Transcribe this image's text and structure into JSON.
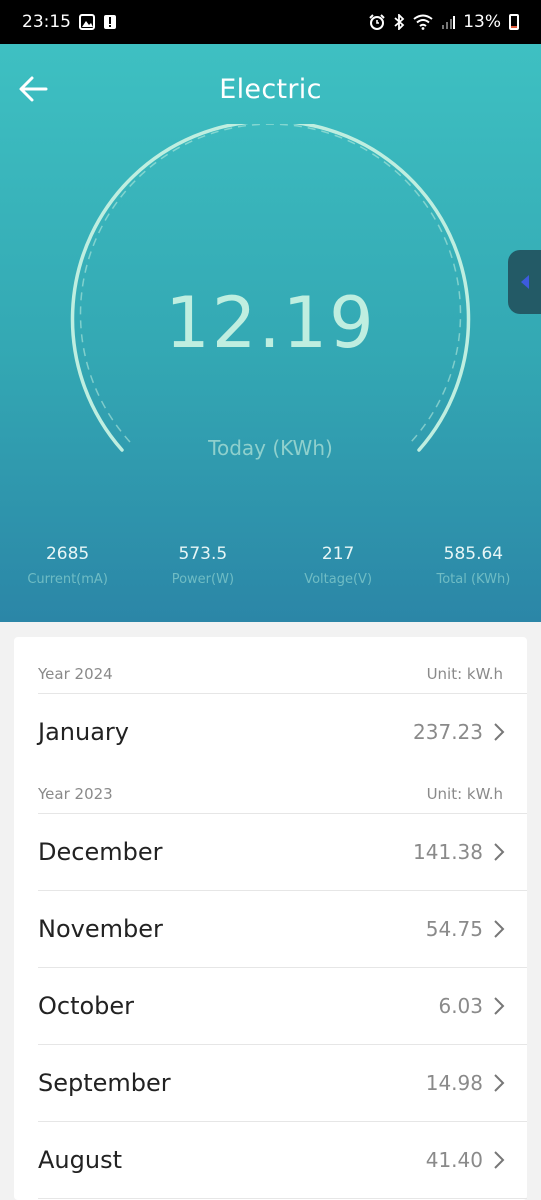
{
  "status_bar": {
    "time": "23:15",
    "battery": "13%",
    "icons": [
      "gallery-icon",
      "alert-icon",
      "alarm-icon",
      "bluetooth-icon",
      "wifi-icon",
      "signal-icon",
      "battery-icon"
    ]
  },
  "header": {
    "title": "Electric",
    "back_icon": "arrow-left-icon"
  },
  "gauge": {
    "value": "12.19",
    "label": "Today (KWh)",
    "colors": {
      "arc": "#bfeee0",
      "text": "#bfeee0",
      "label": "#8fd0cd"
    }
  },
  "side_tab": {
    "icon": "triangle-left-icon",
    "icon_color": "#3d5bdc"
  },
  "stats": [
    {
      "value": "2685",
      "label": "Current(mA)"
    },
    {
      "value": "573.5",
      "label": "Power(W)"
    },
    {
      "value": "217",
      "label": "Voltage(V)"
    },
    {
      "value": "585.64",
      "label": "Total (KWh)"
    }
  ],
  "history": {
    "year_2024": {
      "label": "Year 2024",
      "unit": "Unit: kW.h",
      "months": [
        {
          "name": "January",
          "value": "237.23"
        }
      ]
    },
    "year_2023": {
      "label": "Year 2023",
      "unit": "Unit: kW.h",
      "months": [
        {
          "name": "December",
          "value": "141.38"
        },
        {
          "name": "November",
          "value": "54.75"
        },
        {
          "name": "October",
          "value": "6.03"
        },
        {
          "name": "September",
          "value": "14.98"
        },
        {
          "name": "August",
          "value": "41.40"
        }
      ]
    }
  },
  "colors": {
    "hero_top": "#3ec0c2",
    "hero_bottom": "#2b86a7",
    "card_bg": "#ffffff",
    "page_bg": "#f2f2f2"
  }
}
